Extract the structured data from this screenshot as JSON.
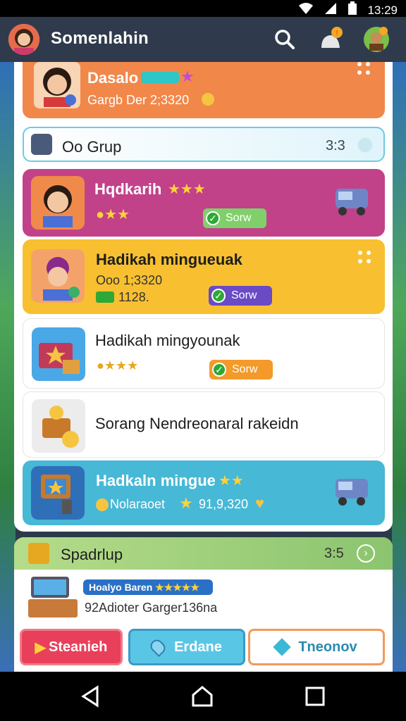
{
  "status_bar": {
    "time": "13:29"
  },
  "top_bar": {
    "title": "Somenlahin"
  },
  "cards": {
    "profile": {
      "name": "Dasalo",
      "subtitle": "Gargb Der 2;3320"
    },
    "group": {
      "label": "Oo Grup",
      "count": "3:3"
    },
    "c1": {
      "title": "Hqdkarih",
      "button": "Sorw"
    },
    "c2": {
      "title": "Hadikah mingueuak",
      "sub1": "Ooo 1;3320",
      "sub2": "1128.",
      "button": "Sorw"
    },
    "c3": {
      "title": "Hadikah mingyounak",
      "button": "Sorw"
    },
    "c4": {
      "title": "Sorang Nendreonaral rakeidn"
    },
    "c5": {
      "title": "Hadkaln mingue",
      "sub": "Nolaraoet",
      "amount": "91,9,320"
    }
  },
  "section2": {
    "header": "Spadrlup",
    "count": "3:5",
    "item_badge": "Hoalyo Baren",
    "item_text": "92Adioter Garger136na"
  },
  "bottom_buttons": {
    "left": "Steanieh",
    "middle": "Erdane",
    "right": "Tneonov"
  },
  "colors": {
    "orange": "#f2874a",
    "magenta": "#c2428a",
    "yellow": "#f8c030",
    "blue": "#47b8d6",
    "green_header": "#8cc46f"
  }
}
